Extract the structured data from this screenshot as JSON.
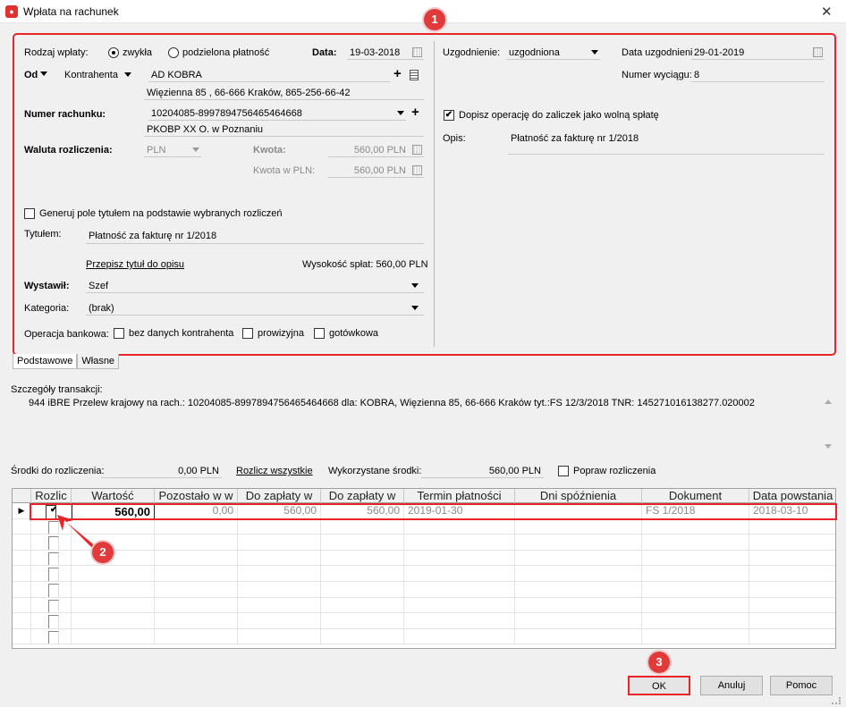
{
  "window": {
    "title": "Wpłata na rachunek",
    "close_glyph": "✕"
  },
  "callouts": [
    "1",
    "2",
    "3"
  ],
  "left": {
    "payment_type_label": "Rodzaj wpłaty:",
    "payment_type_opt1": "zwykła",
    "payment_type_opt2": "podzielona płatność",
    "date_label": "Data:",
    "date_value": "19-03-2018",
    "from_label": "Od",
    "from_type": "Kontrahenta",
    "contractor_name": "AD KOBRA",
    "contractor_address": "Więzienna  85 , 66-666 Kraków, 865-256-66-42",
    "account_label": "Numer rachunku:",
    "account_number": "10204085-8997894756465464668",
    "bank_name": "PKOBP XX O. w Poznaniu",
    "currency_label": "Waluta rozliczenia:",
    "currency_value": "PLN",
    "amount_label": "Kwota:",
    "amount_value": "560,00 PLN",
    "amount_pln_label": "Kwota w PLN:",
    "amount_pln_value": "560,00 PLN",
    "generate_title_label": "Generuj pole tytułem na podstawie wybranych rozliczeń",
    "title_label": "Tytułem:",
    "title_value": "Płatność za fakturę nr 1/2018",
    "copy_title_link": "Przepisz tytuł do opisu",
    "payments_sum": "Wysokość spłat: 560,00 PLN",
    "issuer_label": "Wystawił:",
    "issuer_value": "Szef",
    "category_label": "Kategoria:",
    "category_value": "(brak)",
    "bank_op_label": "Operacja bankowa:",
    "bank_op_opt1": "bez danych kontrahenta",
    "bank_op_opt2": "prowizyjna",
    "bank_op_opt3": "gotówkowa"
  },
  "right": {
    "agreement_label": "Uzgodnienie:",
    "agreement_value": "uzgodniona",
    "agreement_date_label": "Data uzgodnieni",
    "agreement_date_value": "29-01-2019",
    "statement_label": "Numer wyciągu:",
    "statement_value": "8",
    "append_label": "Dopisz operację do zaliczek jako wolną spłatę",
    "append_checked": true,
    "desc_label": "Opis:",
    "desc_value": "Płatność za fakturę nr 1/2018"
  },
  "tabs": [
    "Podstawowe",
    "Własne"
  ],
  "details": {
    "label": "Szczegóły transakcji:",
    "text": "944 iBRE Przelew krajowy  na rach.: 10204085-8997894756465464668  dla: KOBRA, Więzienna 85, 66-666 Kraków  tyt.:FS 12/3/2018  TNR: 145271016138277.020002"
  },
  "settle": {
    "funds_label": "Środki do rozliczenia:",
    "funds_value": "0,00 PLN",
    "settle_all": "Rozlicz wszystkie",
    "used_label": "Wykorzystane środki:",
    "used_value": "560,00 PLN",
    "fix_label": "Popraw rozliczenia"
  },
  "grid": {
    "columns": [
      "Rozlic",
      "Wartość",
      "Pozostało w w",
      "Do zapłaty w",
      "Do zapłaty w",
      "Termin płatności",
      "Dni spóźnienia",
      "Dokument",
      "Data powstania"
    ],
    "rows": [
      {
        "checked": true,
        "value": "560,00",
        "remaining": "0,00",
        "to_pay1": "560,00",
        "to_pay2": "560,00",
        "due_date": "2019-01-30",
        "days_late": "",
        "document": "FS 1/2018",
        "created": "2018-03-10"
      }
    ],
    "empty_rows": 8
  },
  "buttons": {
    "ok": "OK",
    "cancel": "Anuluj",
    "help": "Pomoc"
  },
  "colors": {
    "callout": "#e03a3a",
    "highlight_border": "#e8232a"
  }
}
